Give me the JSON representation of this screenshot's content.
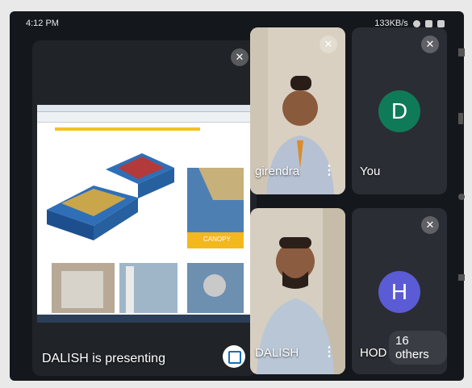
{
  "status_bar": {
    "time": "4:12 PM",
    "right_text": "133KB/s"
  },
  "presentation": {
    "label": "DALISH is presenting",
    "slide_caption": "CANOPY"
  },
  "participants": [
    {
      "name": "girendra"
    },
    {
      "name": "You",
      "initial": "D",
      "avatar_color": "#0f7a58"
    },
    {
      "name": "DALISH"
    },
    {
      "name": "HOD",
      "initial": "H",
      "avatar_color": "#5b5bd6"
    }
  ],
  "others": {
    "label": "16 others"
  },
  "icons": {
    "mic_off": "mic-off-icon",
    "more": "more-vert-icon",
    "fullscreen": "fullscreen-icon"
  }
}
